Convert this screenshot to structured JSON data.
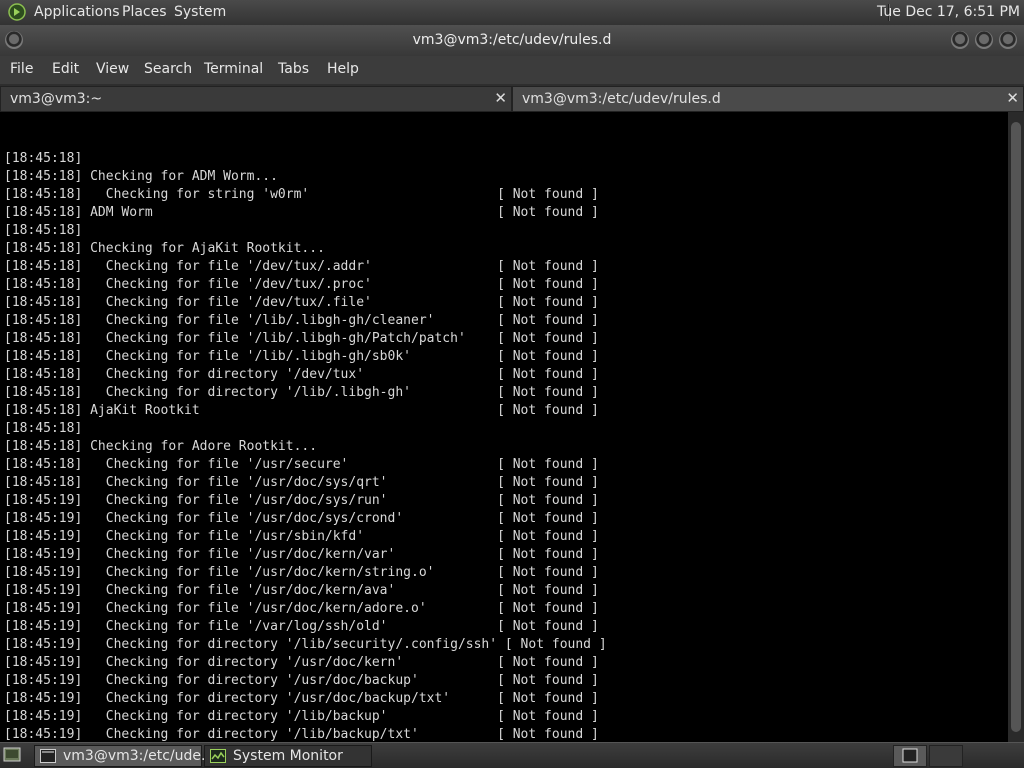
{
  "top_panel": {
    "menus": [
      "Applications",
      "Places",
      "System"
    ],
    "clock": "Tue Dec 17,  6:51 PM"
  },
  "window": {
    "title": "vm3@vm3:/etc/udev/rules.d"
  },
  "menubar": [
    "File",
    "Edit",
    "View",
    "Search",
    "Terminal",
    "Tabs",
    "Help"
  ],
  "tabs": [
    {
      "label": "vm3@vm3:~",
      "close": "✕"
    },
    {
      "label": "vm3@vm3:/etc/udev/rules.d",
      "close": "✕"
    }
  ],
  "terminal": {
    "lines": [
      "[18:45:18]",
      "[18:45:18] Checking for ADM Worm...",
      "[18:45:18]   Checking for string 'w0rm'                        [ Not found ]",
      "[18:45:18] ADM Worm                                            [ Not found ]",
      "[18:45:18]",
      "[18:45:18] Checking for AjaKit Rootkit...",
      "[18:45:18]   Checking for file '/dev/tux/.addr'                [ Not found ]",
      "[18:45:18]   Checking for file '/dev/tux/.proc'                [ Not found ]",
      "[18:45:18]   Checking for file '/dev/tux/.file'                [ Not found ]",
      "[18:45:18]   Checking for file '/lib/.libgh-gh/cleaner'        [ Not found ]",
      "[18:45:18]   Checking for file '/lib/.libgh-gh/Patch/patch'    [ Not found ]",
      "[18:45:18]   Checking for file '/lib/.libgh-gh/sb0k'           [ Not found ]",
      "[18:45:18]   Checking for directory '/dev/tux'                 [ Not found ]",
      "[18:45:18]   Checking for directory '/lib/.libgh-gh'           [ Not found ]",
      "[18:45:18] AjaKit Rootkit                                      [ Not found ]",
      "[18:45:18]",
      "[18:45:18] Checking for Adore Rootkit...",
      "[18:45:18]   Checking for file '/usr/secure'                   [ Not found ]",
      "[18:45:18]   Checking for file '/usr/doc/sys/qrt'              [ Not found ]",
      "[18:45:19]   Checking for file '/usr/doc/sys/run'              [ Not found ]",
      "[18:45:19]   Checking for file '/usr/doc/sys/crond'            [ Not found ]",
      "[18:45:19]   Checking for file '/usr/sbin/kfd'                 [ Not found ]",
      "[18:45:19]   Checking for file '/usr/doc/kern/var'             [ Not found ]",
      "[18:45:19]   Checking for file '/usr/doc/kern/string.o'        [ Not found ]",
      "[18:45:19]   Checking for file '/usr/doc/kern/ava'             [ Not found ]",
      "[18:45:19]   Checking for file '/usr/doc/kern/adore.o'         [ Not found ]",
      "[18:45:19]   Checking for file '/var/log/ssh/old'              [ Not found ]",
      "[18:45:19]   Checking for directory '/lib/security/.config/ssh' [ Not found ]",
      "[18:45:19]   Checking for directory '/usr/doc/kern'            [ Not found ]",
      "[18:45:19]   Checking for directory '/usr/doc/backup'          [ Not found ]",
      "[18:45:19]   Checking for directory '/usr/doc/backup/txt'      [ Not found ]",
      "[18:45:19]   Checking for directory '/lib/backup'              [ Not found ]",
      "[18:45:19]   Checking for directory '/lib/backup/txt'          [ Not found ]"
    ],
    "prompt": ":"
  },
  "taskbar": {
    "tasks": [
      "vm3@vm3:/etc/ude...",
      "System Monitor"
    ]
  }
}
